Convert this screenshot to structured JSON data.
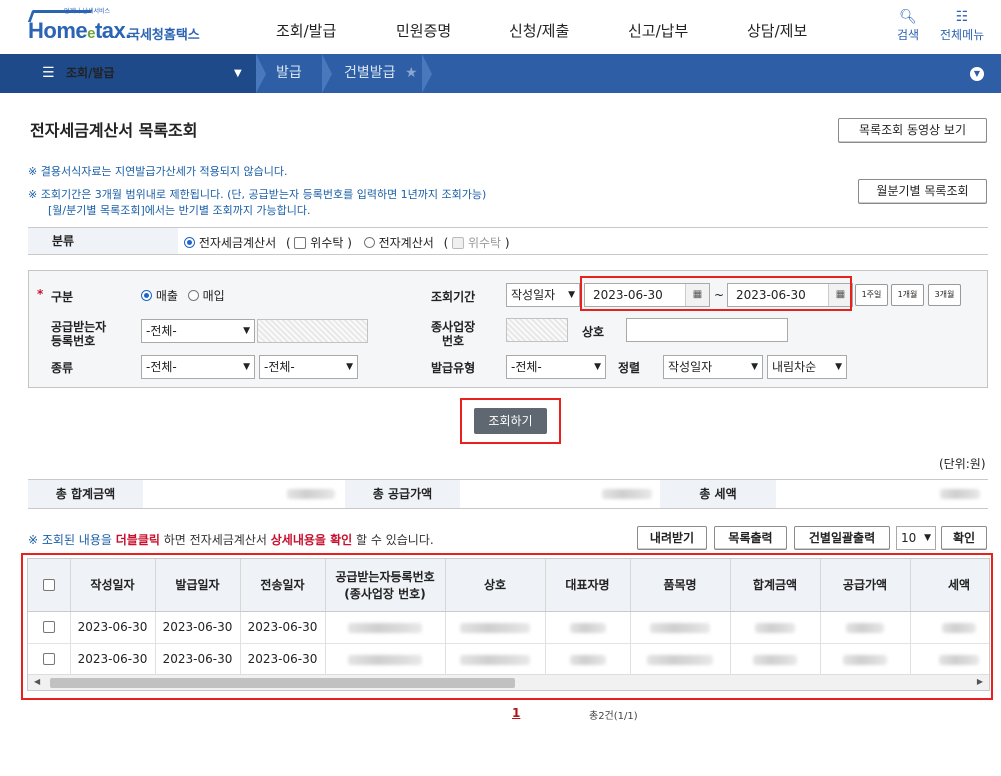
{
  "header": {
    "logo_small": "언제나 납세서비스",
    "logo_home": "Home",
    "logo_e": "e",
    "logo_tax": "tax.",
    "logo_kr": "국세청홈택스",
    "gnb": [
      "조회/발급",
      "민원증명",
      "신청/제출",
      "신고/납부",
      "상담/제보"
    ],
    "search_label": "검색",
    "menu_label": "전체메뉴"
  },
  "nav": {
    "section": "조회/발급",
    "crumbs": [
      "발급",
      "건별발급"
    ]
  },
  "page": {
    "title": "전자세금계산서 목록조회",
    "video_btn": "목록조회 동영상 보기",
    "period_btn": "월분기별 목록조회",
    "notice1": "※ 결용서식자료는 지연발급가산세가 적용되지 않습니다.",
    "notice2": "※ 조회기간은 3개월 범위내로 제한됩니다. (단, 공급받는자 등록번호를 입력하면 1년까지 조회가능)",
    "notice3": "[월/분기별 목록조회]에서는 반기별 조회까지 가능합니다."
  },
  "classification": {
    "label": "분류",
    "opt1": "전자세금계산서",
    "paren_open": "(",
    "trust1": "위수탁",
    "paren_close": ")",
    "opt2": "전자계산서",
    "trust2": "위수탁"
  },
  "search": {
    "gubun_label": "구분",
    "sales": "매출",
    "purchase": "매입",
    "period_label": "조회기간",
    "date_type": "작성일자",
    "start_date": "2023-06-30",
    "tilde": "~",
    "end_date": "2023-06-30",
    "q1": "1주일",
    "q2": "1개월",
    "q3": "3개월",
    "receiver_label_1": "공급받는자",
    "receiver_label_2": "등록번호",
    "receiver_select": "-전체-",
    "biz_label_1": "종사업장",
    "biz_label_2": "번호",
    "company_label": "상호",
    "kind_label": "종류",
    "kind1": "-전체-",
    "kind2": "-전체-",
    "issue_type_label": "발급유형",
    "issue_type": "-전체-",
    "sort_label": "정렬",
    "sort_field": "작성일자",
    "sort_order": "내림차순",
    "submit": "조회하기"
  },
  "totals": {
    "unit": "(단위:원)",
    "sum_label": "총 합계금액",
    "supply_label": "총 공급가액",
    "tax_label": "총 세액"
  },
  "list": {
    "hint_a": "※ 조회된 내용을 ",
    "hint_b": "더블클릭",
    "hint_c": " 하면 전자세금계산서 ",
    "hint_d": "상세내용을 확인",
    "hint_e": " 할 수 있습니다.",
    "download_btn": "내려받기",
    "print_btn": "목록출력",
    "bulk_print_btn": "건별일괄출력",
    "page_size": "10",
    "confirm_btn": "확인",
    "columns": [
      "작성일자",
      "발급일자",
      "전송일자",
      "공급받는자등록번호",
      "(종사업장 번호)",
      "상호",
      "대표자명",
      "품목명",
      "합계금액",
      "공급가액",
      "세액"
    ],
    "rows": [
      {
        "write": "2023-06-30",
        "issue": "2023-06-30",
        "send": "2023-06-30"
      },
      {
        "write": "2023-06-30",
        "issue": "2023-06-30",
        "send": "2023-06-30"
      }
    ],
    "page": "1",
    "count": "총2건(1/1)"
  },
  "colors": {
    "brand_blue": "#2d5ea6",
    "highlight_red": "#e8201e"
  }
}
